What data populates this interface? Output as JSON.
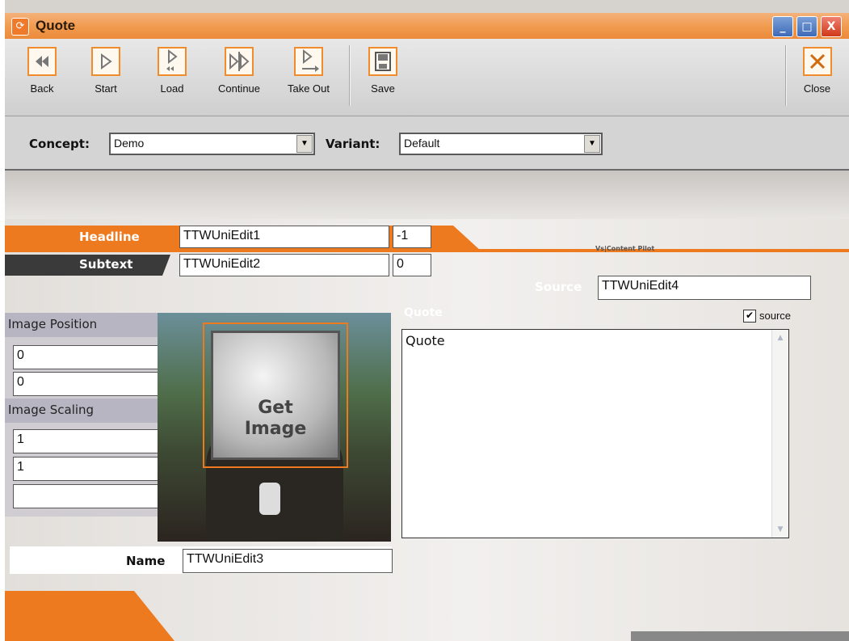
{
  "window": {
    "title": "Quote",
    "controls": [
      "_",
      "□",
      "X"
    ]
  },
  "toolbar": {
    "buttons": [
      {
        "label": "Back",
        "icon": "rewind-icon"
      },
      {
        "label": "Start",
        "icon": "play-icon"
      },
      {
        "label": "Load",
        "icon": "load-icon"
      },
      {
        "label": "Continue",
        "icon": "continue-icon"
      },
      {
        "label": "Take Out",
        "icon": "take-out-icon"
      },
      {
        "label": "Save",
        "icon": "save-icon"
      }
    ],
    "close": {
      "label": "Close",
      "icon": "close-x-icon"
    }
  },
  "concept": {
    "label": "Concept:",
    "value": "Demo"
  },
  "variant": {
    "label": "Variant:",
    "value": "Default"
  },
  "form": {
    "headline": {
      "label": "Headline",
      "value": "TTWUniEdit1",
      "index": "-1"
    },
    "subtext": {
      "label": "Subtext",
      "value": "TTWUniEdit2",
      "index": "0"
    },
    "brand": "Vs|Content Pilot",
    "source": {
      "label": "Source",
      "value": "TTWUniEdit4"
    },
    "image_position": {
      "label": "Image Position",
      "x": "0",
      "y": "0"
    },
    "image_scaling": {
      "label": "Image Scaling",
      "x": "1",
      "y": "1",
      "extra": ""
    },
    "get_image": {
      "line1": "Get",
      "line2": "Image"
    },
    "quote": {
      "label": "Quote",
      "text": "Quote"
    },
    "source_checkbox": {
      "label": "source",
      "checked": true
    },
    "name": {
      "label": "Name",
      "value": "TTWUniEdit3"
    }
  },
  "colors": {
    "accent": "#ee7a1f",
    "dark_bar": "#3a3a3a",
    "titlebar": "#f09a4e"
  }
}
